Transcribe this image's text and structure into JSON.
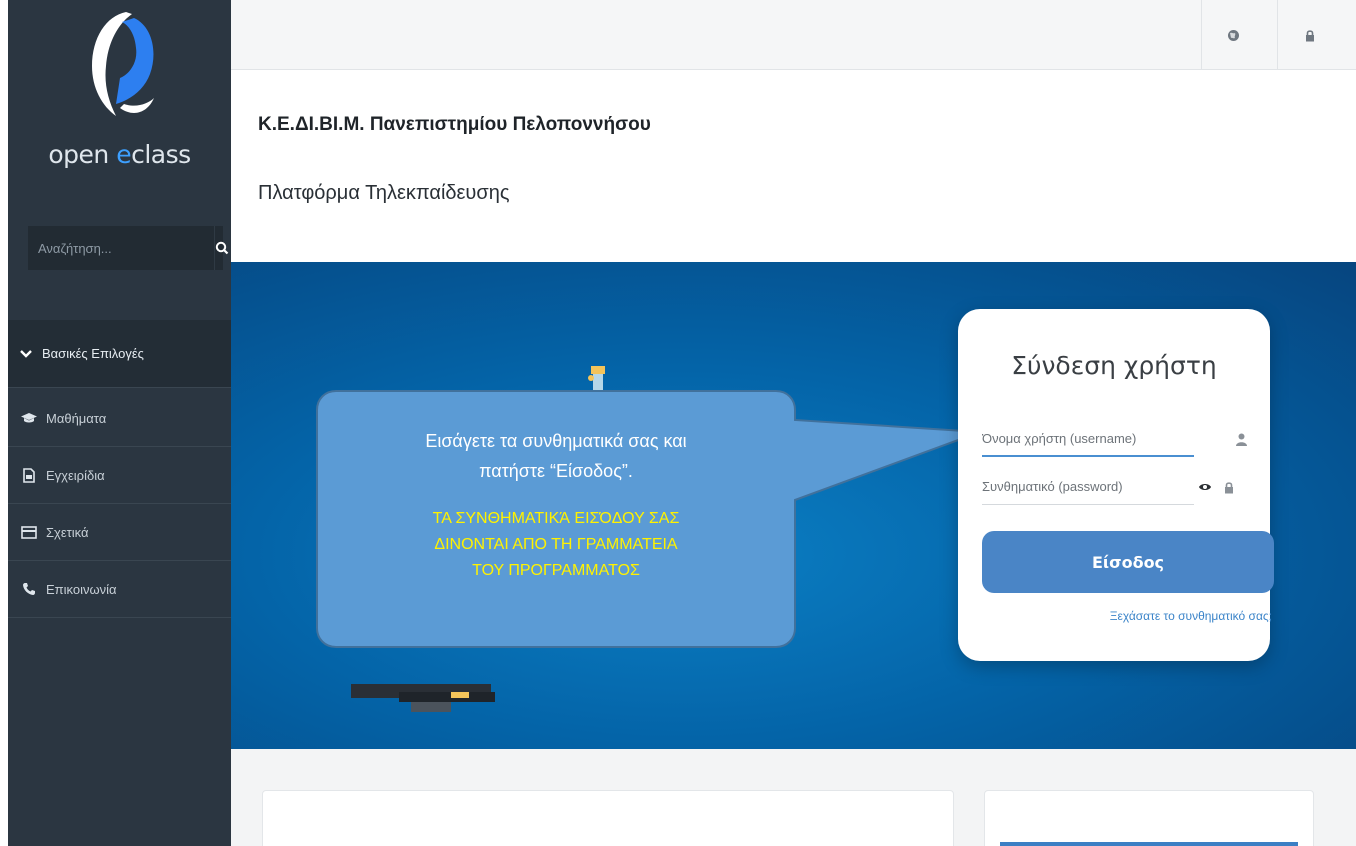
{
  "sidebar": {
    "logo_text_prefix": "open ",
    "logo_text_accent": "e",
    "logo_text_suffix": "class",
    "search_placeholder": "Αναζήτηση...",
    "menu_header": "Βασικές Επιλογές",
    "items": [
      {
        "label": "Μαθήματα",
        "icon": "graduation-cap-icon"
      },
      {
        "label": "Εγχειρίδια",
        "icon": "document-icon"
      },
      {
        "label": "Σχετικά",
        "icon": "card-icon"
      },
      {
        "label": "Επικοινωνία",
        "icon": "phone-icon"
      }
    ]
  },
  "topbar": {
    "icons": [
      "globe-icon",
      "lock-icon"
    ]
  },
  "header": {
    "institution": "Κ.Ε.ΔΙ.ΒΙ.Μ. Πανεπιστημίου Πελοποννήσου",
    "platform": "Πλατφόρμα Τηλεκπαίδευσης"
  },
  "login": {
    "title": "Σύνδεση χρήστη",
    "username_placeholder": "Όνομα χρήστη (username)",
    "password_placeholder": "Συνθηματικό (password)",
    "submit_label": "Είσοδος",
    "forgot_link": "Ξεχάσατε το συνθηματικό σας;"
  },
  "callout": {
    "line1": "Εισάγετε τα συνθηματικά σας και",
    "line2": "πατήστε “Είσοδος”.",
    "note1": "ΤΑ ΣΥΝΘΗΜΑΤΙΚΆ ΕΙΣΌΔΟΥ  ΣΑΣ",
    "note2": "ΔΙΝΟΝΤΑΙ ΑΠΟ ΤΗ ΓΡΑΜΜΑΤΕΙΑ",
    "note3": "ΤΟΥ ΠΡΟΓΡΑΜΜΑΤΟΣ"
  },
  "colors": {
    "sidebar_bg": "#2b3641",
    "hero_blue": "#0464a8",
    "accent": "#4a85c6",
    "callout_fill": "#5b9bd5",
    "note_yellow": "#fff200"
  }
}
